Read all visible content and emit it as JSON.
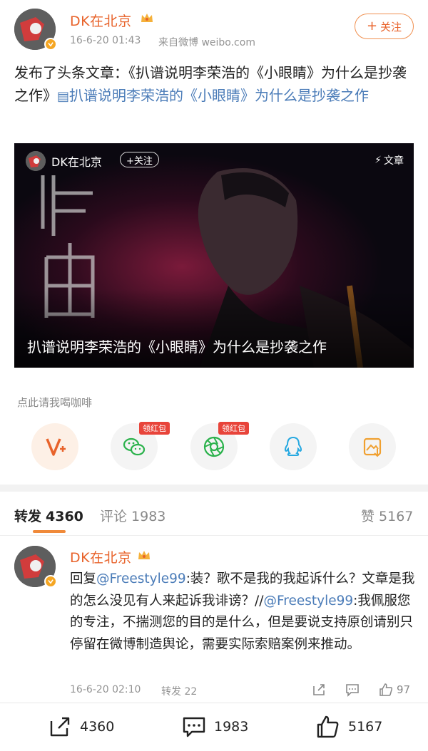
{
  "post": {
    "username": "DK在北京",
    "timestamp": "16-6-20 01:43",
    "source": "来自微博 weibo.com",
    "follow_label": "关注",
    "text_prefix": "发布了头条文章：《扒谱说明李荣浩的《小眼睛》为什么是抄袭之作》",
    "link_text": "扒谱说明李荣浩的《小眼睛》为什么是抄袭之作"
  },
  "card": {
    "username": "DK在北京",
    "follow_label": "+关注",
    "tag": "文章",
    "title": "扒谱说明李荣浩的《小眼睛》为什么是抄袭之作"
  },
  "tip": {
    "label": "点此请我喝咖啡",
    "redpacket_badge": "领红包"
  },
  "share_icons": [
    "vplus-icon",
    "wechat-icon",
    "moments-icon",
    "qq-icon",
    "save-image-icon"
  ],
  "tabs": {
    "repost": {
      "label": "转发",
      "count": "4360"
    },
    "comment": {
      "label": "评论",
      "count": "1983"
    },
    "like": {
      "label": "赞",
      "count": "5167"
    }
  },
  "comment": {
    "username": "DK在北京",
    "reply_word": "回复",
    "mention1": "@Freestyle99",
    "text1": ":装？歌不是我的我起诉什么？文章是我的怎么没见有人来起诉我诽谤？//",
    "mention2": "@Freestyle99",
    "text2": ":我佩服您的专注，不揣测您的目的是什么，但是要说支持原创请别只停留在微博制造舆论，需要实际索赔案例来推动。",
    "timestamp": "16-6-20 02:10",
    "repost_label": "转发 22",
    "like_count": "97"
  },
  "bottom_bar": {
    "repost_count": "4360",
    "comment_count": "1983",
    "like_count": "5167"
  },
  "colors": {
    "accent_orange": "#e8632b",
    "link_blue": "#4b7cb8",
    "badge_red": "#e8443a"
  }
}
